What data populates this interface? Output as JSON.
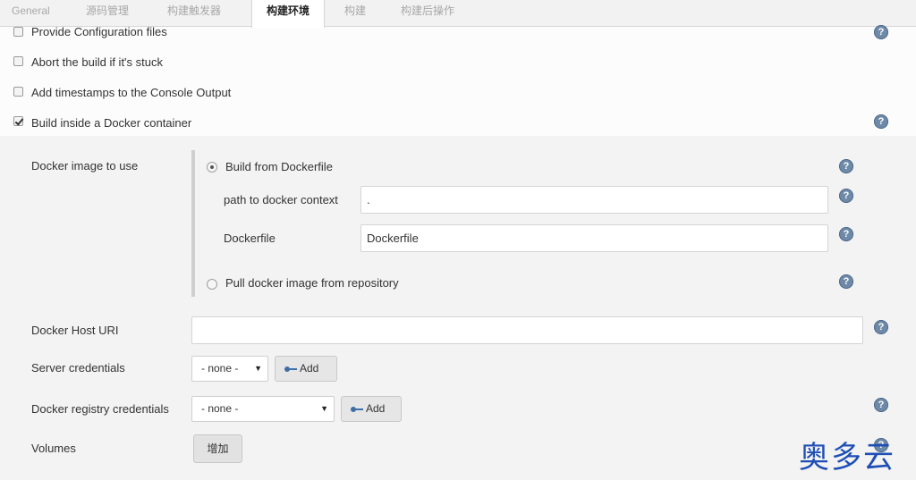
{
  "tabs": [
    {
      "label": "General"
    },
    {
      "label": "源码管理"
    },
    {
      "label": "构建触发器"
    },
    {
      "label": "构建环境"
    },
    {
      "label": "构建"
    },
    {
      "label": "构建后操作"
    }
  ],
  "active_tab": "构建环境",
  "options": [
    {
      "label": "Provide Configuration files",
      "checked": false
    },
    {
      "label": "Abort the build if it's stuck",
      "checked": false
    },
    {
      "label": "Add timestamps to the Console Output",
      "checked": false
    },
    {
      "label": "Build inside a Docker container",
      "checked": true
    }
  ],
  "docker": {
    "image_label": "Docker image to use",
    "build_from_dockerfile": "Build from Dockerfile",
    "context_label": "path to docker context",
    "context_value": ".",
    "dockerfile_label": "Dockerfile",
    "dockerfile_value": "Dockerfile",
    "pull_image": "Pull docker image from repository",
    "host_uri_label": "Docker Host URI",
    "host_uri_value": "",
    "server_credentials_label": "Server credentials",
    "server_credentials_value": "- none -",
    "registry_credentials_label": "Docker registry credentials",
    "registry_credentials_value": "- none -",
    "add_label": "Add",
    "volumes_label": "Volumes",
    "volumes_add_label": "增加"
  },
  "help_glyph": "?",
  "watermark": "奥多云",
  "colors": {
    "help": "#6f8aa8",
    "watermark": "#1f4fb5"
  }
}
